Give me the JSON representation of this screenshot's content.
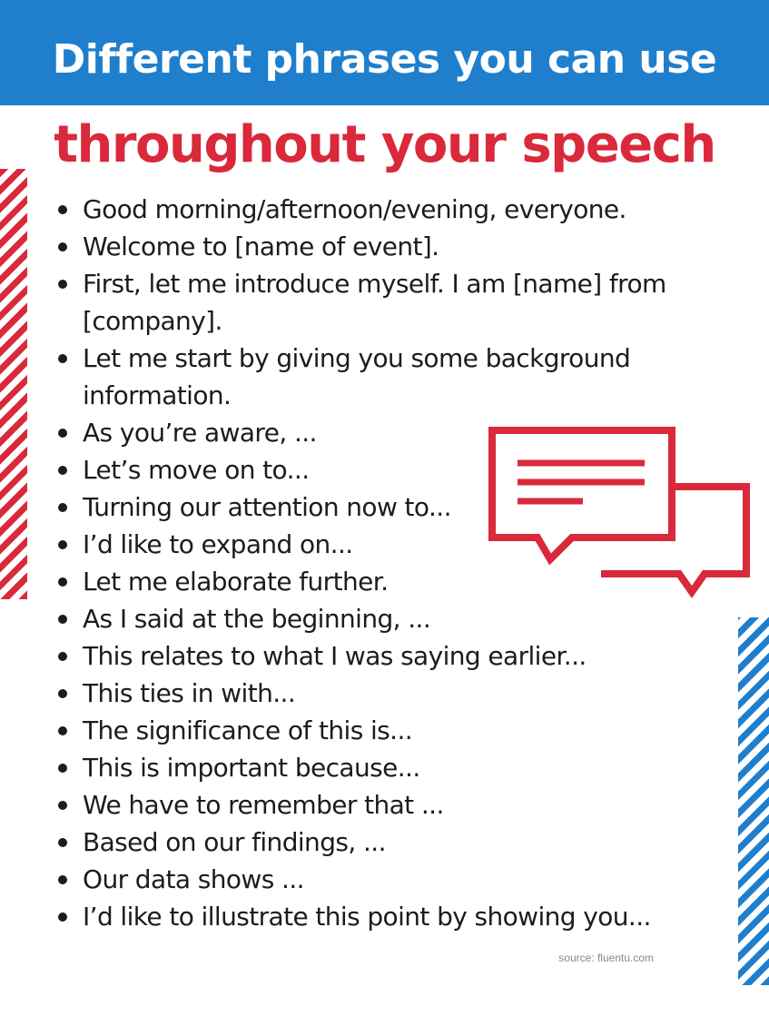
{
  "header": {
    "title": "Different phrases you can use",
    "subtitle": "throughout your speech"
  },
  "phrases": [
    {
      "lines": [
        "Good morning/afternoon/evening, everyone."
      ]
    },
    {
      "lines": [
        "Welcome to [name of event]."
      ]
    },
    {
      "lines": [
        "First, let me introduce myself. I am [name] from",
        "[company]."
      ]
    },
    {
      "lines": [
        "Let me start by giving you some background",
        "information."
      ]
    },
    {
      "lines": [
        "As you’re aware, ..."
      ]
    },
    {
      "lines": [
        "Let’s move on to..."
      ]
    },
    {
      "lines": [
        "Turning our attention now to..."
      ]
    },
    {
      "lines": [
        "I’d like to expand on..."
      ]
    },
    {
      "lines": [
        "Let me elaborate further."
      ]
    },
    {
      "lines": [
        "As I said at the beginning, ..."
      ]
    },
    {
      "lines": [
        "This relates to what I was saying earlier..."
      ]
    },
    {
      "lines": [
        "This ties in with..."
      ]
    },
    {
      "lines": [
        "The significance of this is..."
      ]
    },
    {
      "lines": [
        "This is important because..."
      ]
    },
    {
      "lines": [
        "We have to remember that ..."
      ]
    },
    {
      "lines": [
        "Based on our findings, ..."
      ]
    },
    {
      "lines": [
        "Our data shows ..."
      ]
    },
    {
      "lines": [
        "I’d like to illustrate this point by showing you..."
      ]
    }
  ],
  "footer": {
    "source": "source: fluentu.com"
  },
  "icons": {
    "speech": "speech-bubbles-icon",
    "stripes": "diagonal-stripes"
  },
  "colors": {
    "header_blue": "#1f7fcc",
    "accent_red": "#d9293b",
    "text_dark": "#1c1c1c"
  }
}
